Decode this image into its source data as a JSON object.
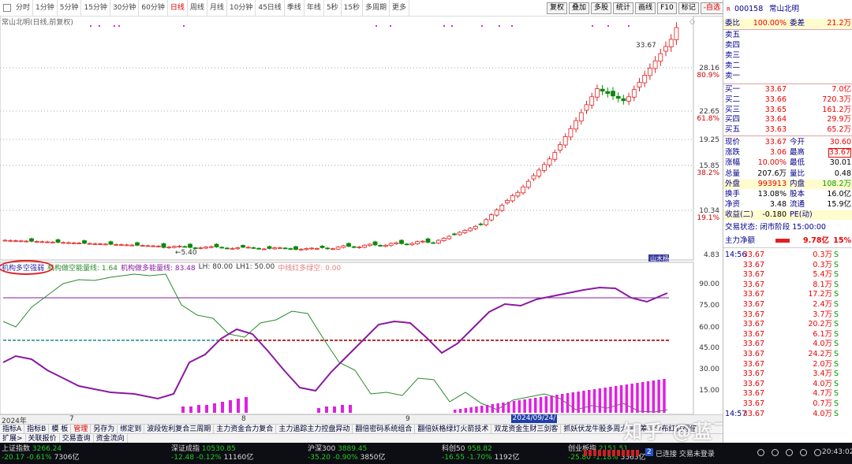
{
  "periodbar": {
    "items": [
      "分时",
      "1分钟",
      "5分钟",
      "15分钟",
      "30分钟",
      "60分钟",
      "日线",
      "周线",
      "月线",
      "10分钟",
      "45日线",
      "季线",
      "年线",
      "5秒",
      "15秒",
      "多周期",
      "更多"
    ],
    "active_index": 6
  },
  "toolbar": {
    "buttons": [
      "复权",
      "叠加",
      "多股",
      "统计",
      "画线",
      "F10",
      "标记",
      "-自选",
      "返回"
    ]
  },
  "chart": {
    "stock_label": "常山北明(日线,前复权)",
    "price_labels": [
      "28.16",
      "80.9%",
      "22.65",
      "61.8%",
      "19.25",
      "15.85",
      "38.2%",
      "10.34",
      "19.1%",
      "4.83"
    ],
    "high_label": "33.67",
    "low_label": "5.40",
    "indicator_scale": [
      "90.00",
      "75.00",
      "60.00",
      "45.00",
      "30.00",
      "15.00"
    ],
    "indicator_box": "山木杨"
  },
  "indicator_legend": [
    {
      "text": "机构多空强弱",
      "color": "#2a2aa0"
    },
    {
      "text": "机构做空能量线: 1.64",
      "color": "#2a8a2a"
    },
    {
      "text": "机构做多能量线: 83.48",
      "color": "#8a1aa0"
    },
    {
      "text": "LH: 80.00",
      "color": "#333333"
    },
    {
      "text": "LH1: 50.00",
      "color": "#333333"
    },
    {
      "text": "中线红多绿空: 0.00",
      "color": "#e08080"
    }
  ],
  "datebar": {
    "labels": [
      "2024年",
      "7",
      "8",
      "9"
    ],
    "highlight": "2024/09/24/二"
  },
  "tabs_row1": [
    "指标A",
    "指标B",
    "模 板",
    "管理",
    "另存为",
    "绑定到",
    "波段佐利复合三周期",
    "主力资金合力复合",
    "主力追踪主力控盘异动",
    "翻倍密码系统组合",
    "翻倍妖格绿灯火箭技术",
    "双龙资金生财三剑客",
    "抓妖伏龙牛股多周大涨",
    "筹码分布红钻翻倍"
  ],
  "tabs_row2": [
    "扩展>",
    "关联报价",
    "交易查询",
    "资金流向"
  ],
  "tabs_row1_active": 3,
  "statusbar": {
    "markets": [
      {
        "name": "上证指数",
        "price": "3266.24",
        "chg": "-20.17",
        "pct": "-0.61%",
        "amount": "7306亿"
      },
      {
        "name": "深证成指",
        "price": "10530.85",
        "chg": "-12.48",
        "pct": "-0.12%",
        "amount": "11160亿"
      },
      {
        "name": "沪深300",
        "price": "3889.45",
        "chg": "-35.20",
        "pct": "-0.90%",
        "amount": "3850亿"
      },
      {
        "name": "科创50",
        "price": "958.82",
        "chg": "-16.55",
        "pct": "-1.70%",
        "amount": "1192亿"
      },
      {
        "name": "创业板指",
        "price": "2151.51",
        "chg": "-25.80",
        "pct": "-1.18%",
        "amount": "5565亿"
      }
    ],
    "connection": "已连接 交易未登录",
    "conn_badge": "2",
    "time": "20:43:02"
  },
  "watermark": "知乎 @蓝飞云指标",
  "quote": {
    "code": "000158",
    "name": "常山北明",
    "wei_bi": {
      "label": "委比",
      "value": "100.00%",
      "label2": "委差",
      "value2": "21.2万"
    },
    "sells": [
      {
        "label": "卖五"
      },
      {
        "label": "卖四"
      },
      {
        "label": "卖三"
      },
      {
        "label": "卖二"
      },
      {
        "label": "卖一"
      }
    ],
    "buys": [
      {
        "label": "买一",
        "price": "33.67",
        "vol": "7.0亿"
      },
      {
        "label": "买二",
        "price": "33.66",
        "vol": "720.3万"
      },
      {
        "label": "买三",
        "price": "33.65",
        "vol": "161.2万"
      },
      {
        "label": "买四",
        "price": "33.64",
        "vol": "29.9万"
      },
      {
        "label": "买五",
        "price": "33.63",
        "vol": "65.2万"
      }
    ],
    "stats": [
      {
        "l1": "现价",
        "v1": "33.67",
        "c1": "red",
        "l2": "今开",
        "v2": "30.60",
        "c2": "red"
      },
      {
        "l1": "涨跌",
        "v1": "3.06",
        "c1": "red",
        "l2": "最高",
        "v2": "33.67",
        "c2": "red"
      },
      {
        "l1": "涨幅",
        "v1": "10.00%",
        "c1": "red",
        "l2": "最低",
        "v2": "30.01",
        "c2": "blk"
      },
      {
        "l1": "总量",
        "v1": "207.6万",
        "c1": "blk",
        "l2": "量比",
        "v2": "0.48",
        "c2": "blk"
      },
      {
        "l1": "外盘",
        "v1": "993913",
        "c1": "red",
        "l2": "内盘",
        "v2": "108.2万",
        "c2": "green"
      },
      {
        "l1": "换手",
        "v1": "13.08%",
        "c1": "blk",
        "l2": "股本",
        "v2": "16.0亿",
        "c2": "blk"
      },
      {
        "l1": "净资",
        "v1": "3.48",
        "c1": "blk",
        "l2": "流通",
        "v2": "15.9亿",
        "c2": "blk"
      },
      {
        "l1": "收益(二)",
        "v1": "-0.180",
        "c1": "blk",
        "l2": "PE(动)",
        "v2": "",
        "c2": "blk"
      }
    ],
    "trade_status": "交易状态: 闭市阶段 15:00:00",
    "main_net": {
      "label": "主力净额",
      "value": "9.78亿",
      "pct": "15%"
    },
    "ticks": [
      {
        "t": "14:56",
        "p": "33.67",
        "v": "0.3万",
        "s": "S"
      },
      {
        "t": "",
        "p": "33.67",
        "v": "0.3万",
        "s": "S"
      },
      {
        "t": "",
        "p": "33.67",
        "v": "5.4万",
        "s": "S"
      },
      {
        "t": "",
        "p": "33.67",
        "v": "8.1万",
        "s": "S"
      },
      {
        "t": "",
        "p": "33.67",
        "v": "17.2万",
        "s": "S"
      },
      {
        "t": "",
        "p": "33.67",
        "v": "2.4万",
        "s": "S"
      },
      {
        "t": "",
        "p": "33.67",
        "v": "3.7万",
        "s": "S"
      },
      {
        "t": "",
        "p": "33.67",
        "v": "20.2万",
        "s": "S"
      },
      {
        "t": "",
        "p": "33.67",
        "v": "6.1万",
        "s": "S"
      },
      {
        "t": "",
        "p": "33.67",
        "v": "4.0万",
        "s": "S"
      },
      {
        "t": "",
        "p": "33.67",
        "v": "24.2万",
        "s": "S"
      },
      {
        "t": "",
        "p": "33.67",
        "v": "2.0万",
        "s": "S"
      },
      {
        "t": "",
        "p": "33.67",
        "v": "3.4万",
        "s": "S"
      },
      {
        "t": "",
        "p": "33.67",
        "v": "4.0万",
        "s": "S"
      },
      {
        "t": "",
        "p": "33.67",
        "v": "4.7万",
        "s": "S"
      },
      {
        "t": "",
        "p": "33.67",
        "v": "0.7万",
        "s": "S"
      },
      {
        "t": "14:57",
        "p": "33.67",
        "v": "4.0万",
        "s": "S"
      }
    ]
  },
  "colors": {
    "up": "#e02020",
    "down": "#0a8a0a",
    "purple": "#8a1aa0",
    "magenta": "#e020e0",
    "green_line": "#2a8a2a",
    "teal": "#1a8a8a"
  }
}
